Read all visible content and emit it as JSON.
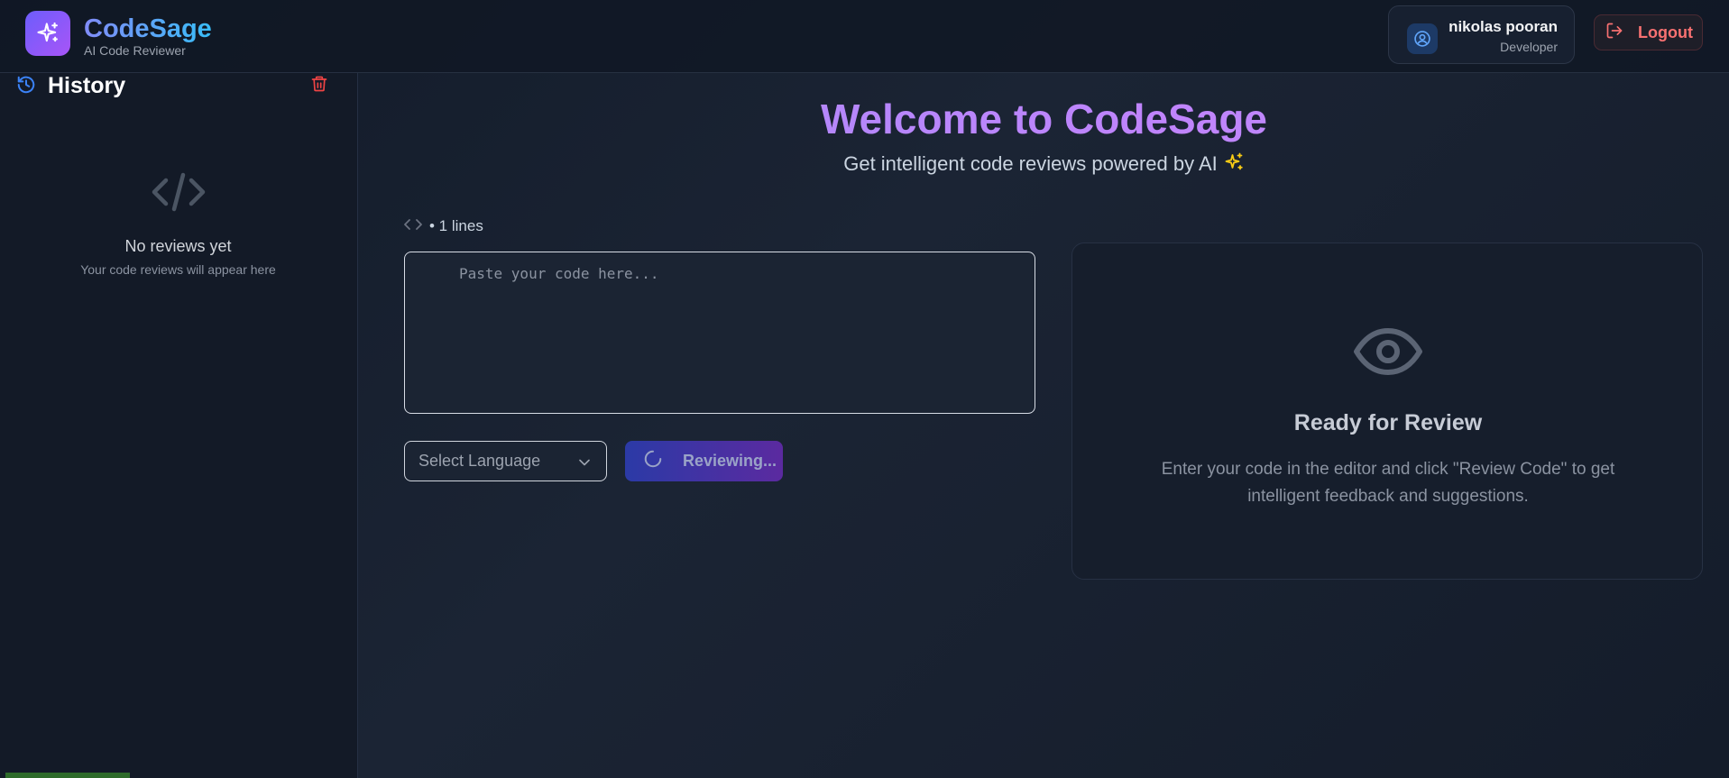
{
  "header": {
    "brand": "CodeSage",
    "brand_subtitle": "AI Code Reviewer",
    "user_name": "nikolas pooran",
    "user_role": "Developer",
    "logout_label": "Logout"
  },
  "sidebar": {
    "title": "History",
    "empty_title": "No reviews yet",
    "empty_subtitle": "Your code reviews will appear here"
  },
  "main": {
    "welcome": "Welcome to CodeSage",
    "subtitle": "Get intelligent code reviews powered by AI",
    "line_count": "• 1 lines",
    "editor_placeholder": "Paste your code here...",
    "language_select": "Select Language",
    "review_button": "Reviewing..."
  },
  "review_panel": {
    "title": "Ready for Review",
    "description": "Enter your code in the editor and click \"Review Code\" to get intelligent feedback and suggestions."
  },
  "colors": {
    "accent_purple": "#a78bfa",
    "accent_blue": "#38bdf8",
    "danger": "#f87171"
  }
}
